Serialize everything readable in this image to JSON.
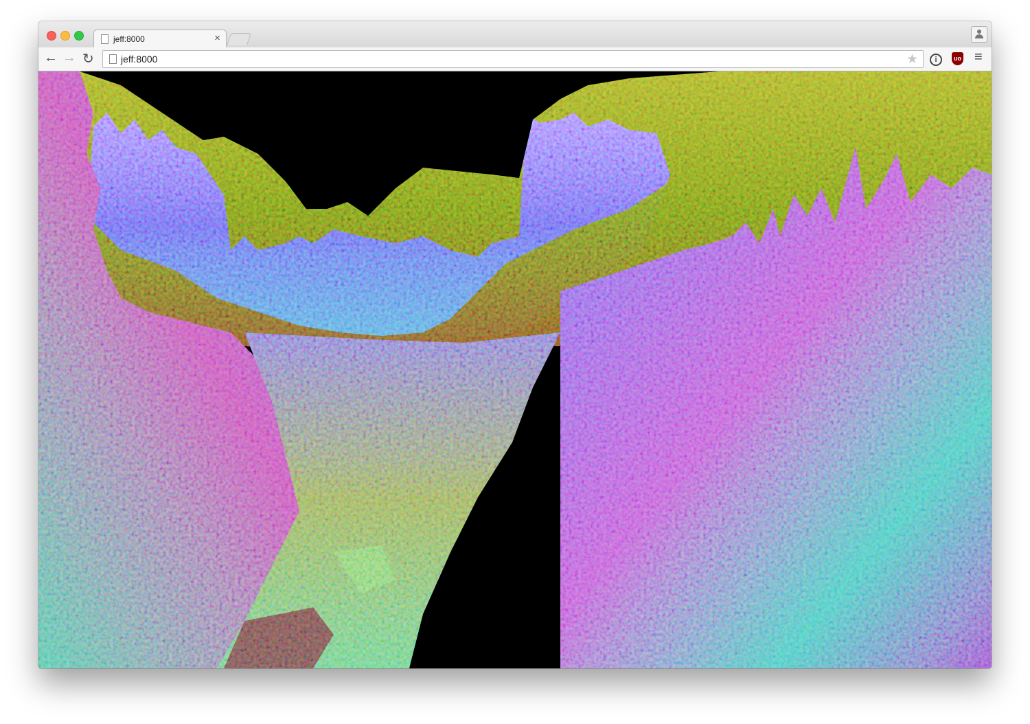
{
  "window": {
    "traffic_lights": [
      "close",
      "minimize",
      "maximize"
    ]
  },
  "tab": {
    "title": "jeff:8000",
    "close_glyph": "×",
    "favicon": "page-icon"
  },
  "toolbar": {
    "back_glyph": "←",
    "forward_glyph": "→",
    "reload_glyph": "↻",
    "url": "jeff:8000",
    "bookmark_glyph": "★",
    "info_glyph": "i",
    "ublock_glyph": "uo",
    "menu_glyph": "≡"
  },
  "viewport": {
    "content": "webgl-terrain-canvas",
    "colors": {
      "sky": "#000000",
      "hill_green": "#7a9a20",
      "cliff_violet": "#7b6cf2",
      "floor_teal": "#4ec7b8",
      "floor_magenta": "#c24fc9"
    }
  }
}
